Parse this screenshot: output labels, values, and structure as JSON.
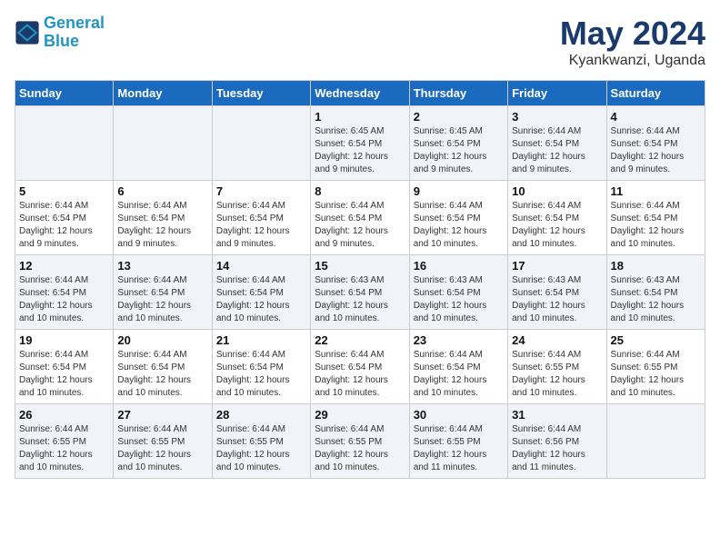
{
  "header": {
    "logo_line1": "General",
    "logo_line2": "Blue",
    "month": "May 2024",
    "location": "Kyankwanzi, Uganda"
  },
  "weekdays": [
    "Sunday",
    "Monday",
    "Tuesday",
    "Wednesday",
    "Thursday",
    "Friday",
    "Saturday"
  ],
  "weeks": [
    [
      {
        "day": "",
        "info": ""
      },
      {
        "day": "",
        "info": ""
      },
      {
        "day": "",
        "info": ""
      },
      {
        "day": "1",
        "info": "Sunrise: 6:45 AM\nSunset: 6:54 PM\nDaylight: 12 hours\nand 9 minutes."
      },
      {
        "day": "2",
        "info": "Sunrise: 6:45 AM\nSunset: 6:54 PM\nDaylight: 12 hours\nand 9 minutes."
      },
      {
        "day": "3",
        "info": "Sunrise: 6:44 AM\nSunset: 6:54 PM\nDaylight: 12 hours\nand 9 minutes."
      },
      {
        "day": "4",
        "info": "Sunrise: 6:44 AM\nSunset: 6:54 PM\nDaylight: 12 hours\nand 9 minutes."
      }
    ],
    [
      {
        "day": "5",
        "info": "Sunrise: 6:44 AM\nSunset: 6:54 PM\nDaylight: 12 hours\nand 9 minutes."
      },
      {
        "day": "6",
        "info": "Sunrise: 6:44 AM\nSunset: 6:54 PM\nDaylight: 12 hours\nand 9 minutes."
      },
      {
        "day": "7",
        "info": "Sunrise: 6:44 AM\nSunset: 6:54 PM\nDaylight: 12 hours\nand 9 minutes."
      },
      {
        "day": "8",
        "info": "Sunrise: 6:44 AM\nSunset: 6:54 PM\nDaylight: 12 hours\nand 9 minutes."
      },
      {
        "day": "9",
        "info": "Sunrise: 6:44 AM\nSunset: 6:54 PM\nDaylight: 12 hours\nand 10 minutes."
      },
      {
        "day": "10",
        "info": "Sunrise: 6:44 AM\nSunset: 6:54 PM\nDaylight: 12 hours\nand 10 minutes."
      },
      {
        "day": "11",
        "info": "Sunrise: 6:44 AM\nSunset: 6:54 PM\nDaylight: 12 hours\nand 10 minutes."
      }
    ],
    [
      {
        "day": "12",
        "info": "Sunrise: 6:44 AM\nSunset: 6:54 PM\nDaylight: 12 hours\nand 10 minutes."
      },
      {
        "day": "13",
        "info": "Sunrise: 6:44 AM\nSunset: 6:54 PM\nDaylight: 12 hours\nand 10 minutes."
      },
      {
        "day": "14",
        "info": "Sunrise: 6:44 AM\nSunset: 6:54 PM\nDaylight: 12 hours\nand 10 minutes."
      },
      {
        "day": "15",
        "info": "Sunrise: 6:43 AM\nSunset: 6:54 PM\nDaylight: 12 hours\nand 10 minutes."
      },
      {
        "day": "16",
        "info": "Sunrise: 6:43 AM\nSunset: 6:54 PM\nDaylight: 12 hours\nand 10 minutes."
      },
      {
        "day": "17",
        "info": "Sunrise: 6:43 AM\nSunset: 6:54 PM\nDaylight: 12 hours\nand 10 minutes."
      },
      {
        "day": "18",
        "info": "Sunrise: 6:43 AM\nSunset: 6:54 PM\nDaylight: 12 hours\nand 10 minutes."
      }
    ],
    [
      {
        "day": "19",
        "info": "Sunrise: 6:44 AM\nSunset: 6:54 PM\nDaylight: 12 hours\nand 10 minutes."
      },
      {
        "day": "20",
        "info": "Sunrise: 6:44 AM\nSunset: 6:54 PM\nDaylight: 12 hours\nand 10 minutes."
      },
      {
        "day": "21",
        "info": "Sunrise: 6:44 AM\nSunset: 6:54 PM\nDaylight: 12 hours\nand 10 minutes."
      },
      {
        "day": "22",
        "info": "Sunrise: 6:44 AM\nSunset: 6:54 PM\nDaylight: 12 hours\nand 10 minutes."
      },
      {
        "day": "23",
        "info": "Sunrise: 6:44 AM\nSunset: 6:54 PM\nDaylight: 12 hours\nand 10 minutes."
      },
      {
        "day": "24",
        "info": "Sunrise: 6:44 AM\nSunset: 6:55 PM\nDaylight: 12 hours\nand 10 minutes."
      },
      {
        "day": "25",
        "info": "Sunrise: 6:44 AM\nSunset: 6:55 PM\nDaylight: 12 hours\nand 10 minutes."
      }
    ],
    [
      {
        "day": "26",
        "info": "Sunrise: 6:44 AM\nSunset: 6:55 PM\nDaylight: 12 hours\nand 10 minutes."
      },
      {
        "day": "27",
        "info": "Sunrise: 6:44 AM\nSunset: 6:55 PM\nDaylight: 12 hours\nand 10 minutes."
      },
      {
        "day": "28",
        "info": "Sunrise: 6:44 AM\nSunset: 6:55 PM\nDaylight: 12 hours\nand 10 minutes."
      },
      {
        "day": "29",
        "info": "Sunrise: 6:44 AM\nSunset: 6:55 PM\nDaylight: 12 hours\nand 10 minutes."
      },
      {
        "day": "30",
        "info": "Sunrise: 6:44 AM\nSunset: 6:55 PM\nDaylight: 12 hours\nand 11 minutes."
      },
      {
        "day": "31",
        "info": "Sunrise: 6:44 AM\nSunset: 6:56 PM\nDaylight: 12 hours\nand 11 minutes."
      },
      {
        "day": "",
        "info": ""
      }
    ]
  ]
}
